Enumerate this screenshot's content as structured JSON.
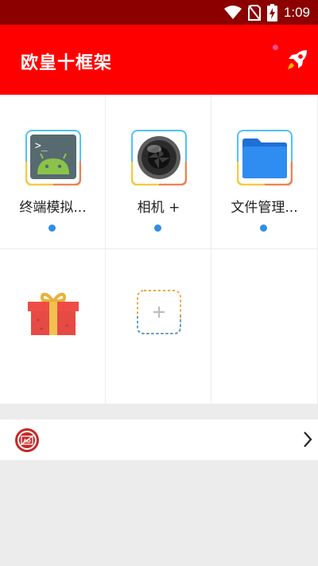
{
  "status_bar": {
    "time": "1:09"
  },
  "app_bar": {
    "title": "欧皇十框架"
  },
  "apps": [
    {
      "label": "终端模拟...",
      "icon": "android-terminal-icon",
      "has_dot": true
    },
    {
      "label": "相机 +",
      "icon": "camera-lens-icon",
      "has_dot": true
    },
    {
      "label": "文件管理...",
      "icon": "folder-icon",
      "has_dot": true
    },
    {
      "label": "",
      "icon": "gift-icon",
      "has_dot": false
    },
    {
      "label": "",
      "icon": "add-app-icon",
      "has_dot": false
    }
  ],
  "notice_row": {
    "icon": "ad-block-icon",
    "arrow": "chevron-right-icon"
  },
  "colors": {
    "status_bar": "#8c0000",
    "app_bar": "#ff0000",
    "dot": "#2f8fe8"
  }
}
